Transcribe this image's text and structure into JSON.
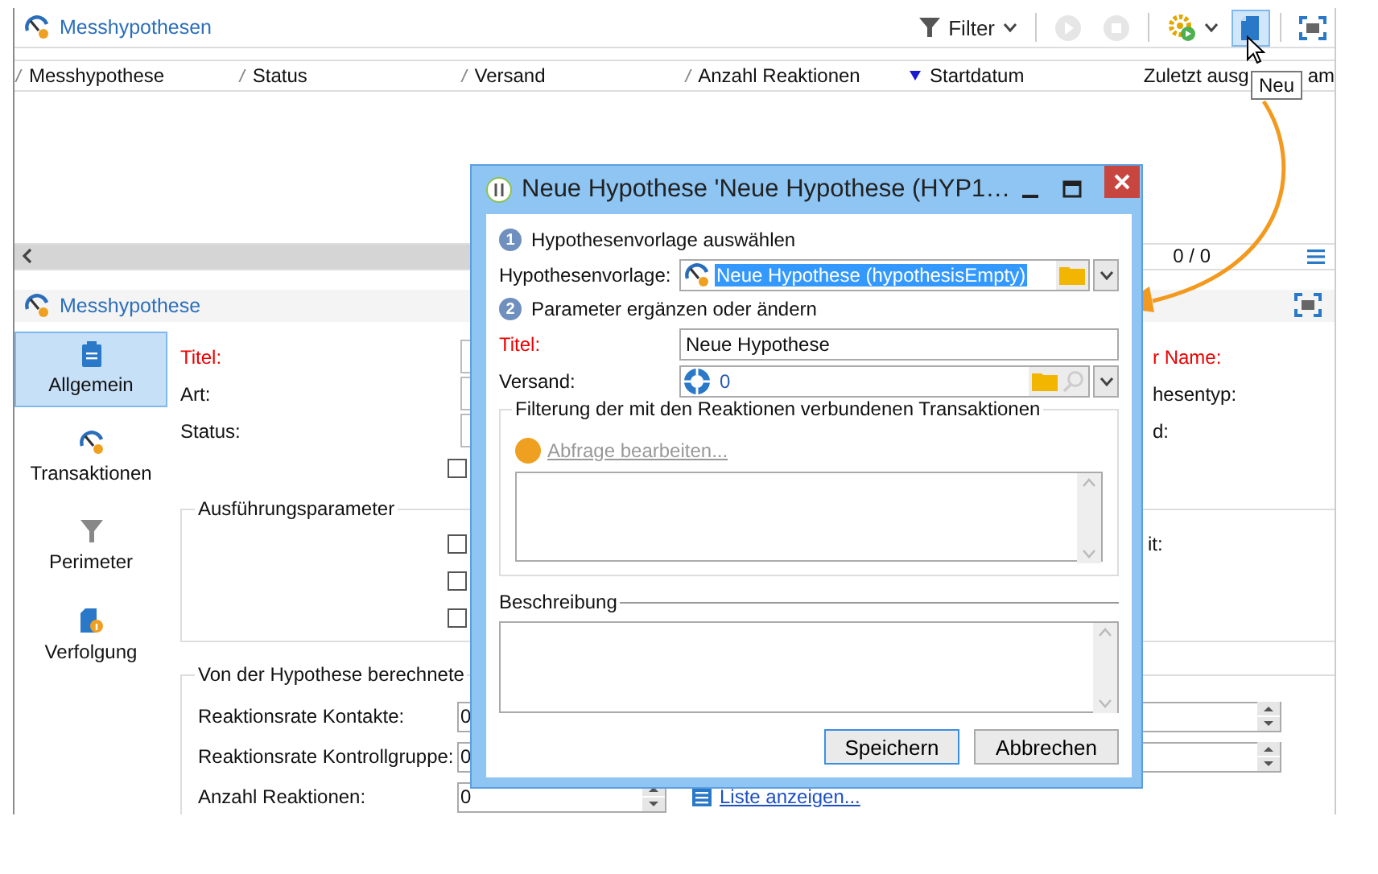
{
  "list_panel": {
    "title": "Messhypothesen",
    "toolbar": [
      {
        "kind": "filter",
        "label": "Filter",
        "disabled": false,
        "selected": false
      },
      {
        "kind": "play",
        "disabled": true,
        "selected": false
      },
      {
        "kind": "stop",
        "disabled": true,
        "selected": false
      },
      {
        "kind": "gear",
        "disabled": false,
        "selected": false
      },
      {
        "kind": "new",
        "disabled": false,
        "selected": true
      },
      {
        "kind": "expand",
        "disabled": false,
        "selected": false
      }
    ],
    "tooltip": "Neu",
    "columns": [
      {
        "label": "Messhypothese",
        "sorted": false
      },
      {
        "label": "Status",
        "sorted": false
      },
      {
        "label": "Versand",
        "sorted": false
      },
      {
        "label": "Anzahl Reaktionen",
        "sorted": false
      },
      {
        "label": "Startdatum",
        "sorted": true
      },
      {
        "label": "Zuletzt ausg",
        "sorted": false
      }
    ],
    "column_tail": "am",
    "count": "0 / 0"
  },
  "detail_panel": {
    "title": "Messhypothese",
    "sidebar": [
      {
        "label": "Allgemein",
        "kind": "clipboard",
        "selected": true
      },
      {
        "label": "Transaktionen",
        "kind": "gauge",
        "selected": false
      },
      {
        "label": "Perimeter",
        "kind": "funnel",
        "selected": false
      },
      {
        "label": "Verfolgung",
        "kind": "document",
        "selected": false
      }
    ],
    "fields": [
      {
        "label": "Titel:",
        "required": true,
        "right_label": "r Name:",
        "right_required": true
      },
      {
        "label": "Art:",
        "required": false,
        "right_label": "hesentyp:",
        "right_required": false
      },
      {
        "label": "Status:",
        "required": false,
        "right_label": "d:",
        "right_required": false
      }
    ],
    "checkbox": {
      "checked": false
    },
    "execution_group": {
      "title": "Ausführungsparameter",
      "right_label": "it:",
      "checkboxes": [
        {
          "checked": false
        },
        {
          "checked": false
        },
        {
          "checked": false
        }
      ]
    },
    "indicators": {
      "title": "Von der Hypothese berechnete",
      "rows": [
        {
          "label": "Reaktionsrate Kontakte:",
          "value": "0",
          "right_field": true
        },
        {
          "label": "Reaktionsrate Kontrollgruppe:",
          "value": "0",
          "right_field": true
        },
        {
          "label": "Anzahl Reaktionen:",
          "value": "0",
          "right_field": false,
          "link": "Liste anzeigen..."
        }
      ]
    }
  },
  "dialog": {
    "title": "Neue Hypothese 'Neue Hypothese (HYP1…",
    "steps": [
      {
        "number": "1",
        "label": "Hypothesenvorlage auswählen"
      },
      {
        "number": "2",
        "label": "Parameter ergänzen oder ändern"
      }
    ],
    "template": {
      "label": "Hypothesenvorlage:",
      "value": "Neue Hypothese (hypothesisEmpty)",
      "highlighted": true
    },
    "title_field": {
      "label": "Titel:",
      "value": "Neue Hypothese",
      "required": true
    },
    "delivery": {
      "label": "Versand:",
      "value": "0"
    },
    "filter_group": {
      "title": "Filterung der mit den Reaktionen verbundenen Transaktionen",
      "link": "Abfrage bearbeiten...",
      "link_disabled": true
    },
    "description": {
      "label": "Beschreibung"
    },
    "buttons": [
      {
        "label": "Speichern",
        "default": true
      },
      {
        "label": "Abbrechen",
        "default": false
      }
    ]
  }
}
